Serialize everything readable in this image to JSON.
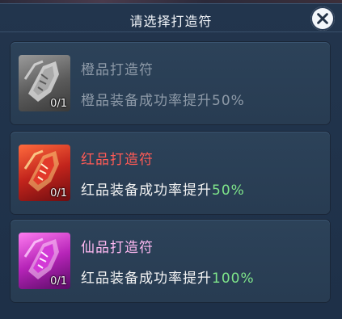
{
  "dialog": {
    "title": "请选择打造符"
  },
  "items": [
    {
      "name": "橙品打造符",
      "desc_prefix": "橙品装备成功率提升",
      "desc_pct": "50%",
      "count": "0/1",
      "icon": "gray-talisman-icon",
      "name_color": "#8e9aa8"
    },
    {
      "name": "红品打造符",
      "desc_prefix": "红品装备成功率提升",
      "desc_pct": "50%",
      "count": "0/1",
      "icon": "red-talisman-icon",
      "name_color": "#ff5a55"
    },
    {
      "name": "仙品打造符",
      "desc_prefix": "红品装备成功率提升",
      "desc_pct": "100%",
      "count": "0/1",
      "icon": "purple-talisman-icon",
      "name_color": "#ffb9f2"
    }
  ]
}
